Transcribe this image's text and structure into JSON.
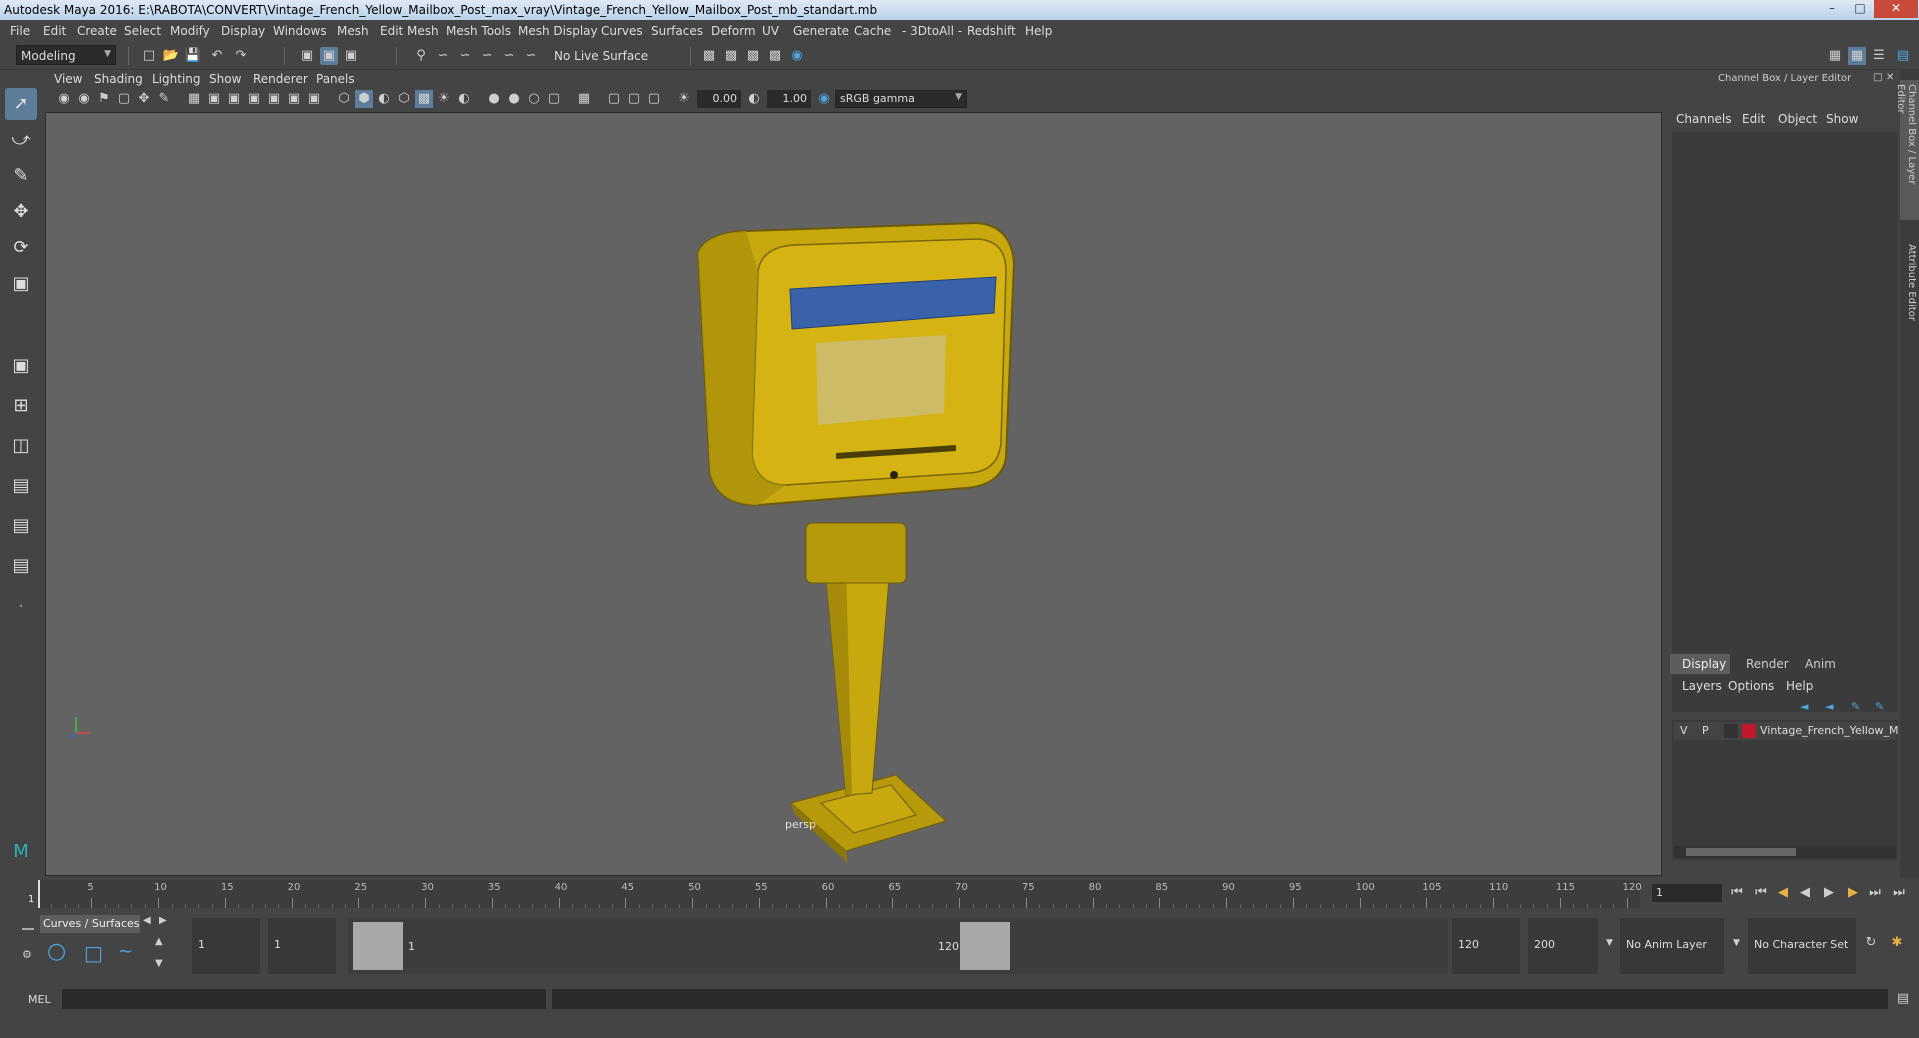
{
  "window": {
    "title": "Autodesk Maya 2016: E:\\RABOTA\\CONVERT\\Vintage_French_Yellow_Mailbox_Post_max_vray\\Vintage_French_Yellow_Mailbox_Post_mb_standart.mb",
    "minimize_icon": "minimize-icon",
    "maximize_icon": "maximize-icon",
    "close_icon": "close-icon"
  },
  "menubar": [
    "File",
    "Edit",
    "Create",
    "Select",
    "Modify",
    "Display",
    "Windows",
    "Mesh",
    "Edit Mesh",
    "Mesh Tools",
    "Mesh Display",
    "Curves",
    "Surfaces",
    "Deform",
    "UV",
    "Generate",
    "Cache",
    "- 3DtoAll -",
    "Redshift",
    "Help"
  ],
  "statusline": {
    "mode": "Modeling",
    "live_surface": "No Live Surface"
  },
  "panel_menu": [
    "View",
    "Shading",
    "Lighting",
    "Show",
    "Renderer",
    "Panels"
  ],
  "panel_toolbar": {
    "exposure": "0.00",
    "gamma": "1.00",
    "color_space": "sRGB gamma"
  },
  "viewport": {
    "camera": "persp",
    "background": "#636363",
    "model_color": "#c7a80f",
    "label_color": "#3a62a8"
  },
  "channel_box": {
    "header": "Channel Box / Layer Editor",
    "menus": [
      "Channels",
      "Edit",
      "Object",
      "Show"
    ],
    "tabs": [
      "Display",
      "Render",
      "Anim"
    ],
    "active_tab": "Display",
    "layer_menus": [
      "Layers",
      "Options",
      "Help"
    ],
    "layer": {
      "visible": "V",
      "playback": "P",
      "name": "Vintage_French_Yellow_M",
      "color": "#c0182a"
    }
  },
  "side_tabs": [
    "Channel Box / Layer Editor",
    "Attribute Editor"
  ],
  "timeline": {
    "ticks": [
      "5",
      "10",
      "15",
      "20",
      "25",
      "30",
      "35",
      "40",
      "45",
      "50",
      "55",
      "60",
      "65",
      "70",
      "75",
      "80",
      "85",
      "90",
      "95",
      "100",
      "105",
      "110",
      "115",
      "120"
    ],
    "start_label": "1",
    "current_frame": "1"
  },
  "range": {
    "shelf_label": "Curves / Surfaces",
    "start": "1",
    "anim_start": "1",
    "slider_start": "1",
    "slider_end": "120",
    "end": "120",
    "anim_end": "200",
    "anim_layer": "No Anim Layer",
    "character_set": "No Character Set"
  },
  "cmdline": {
    "label": "MEL"
  }
}
